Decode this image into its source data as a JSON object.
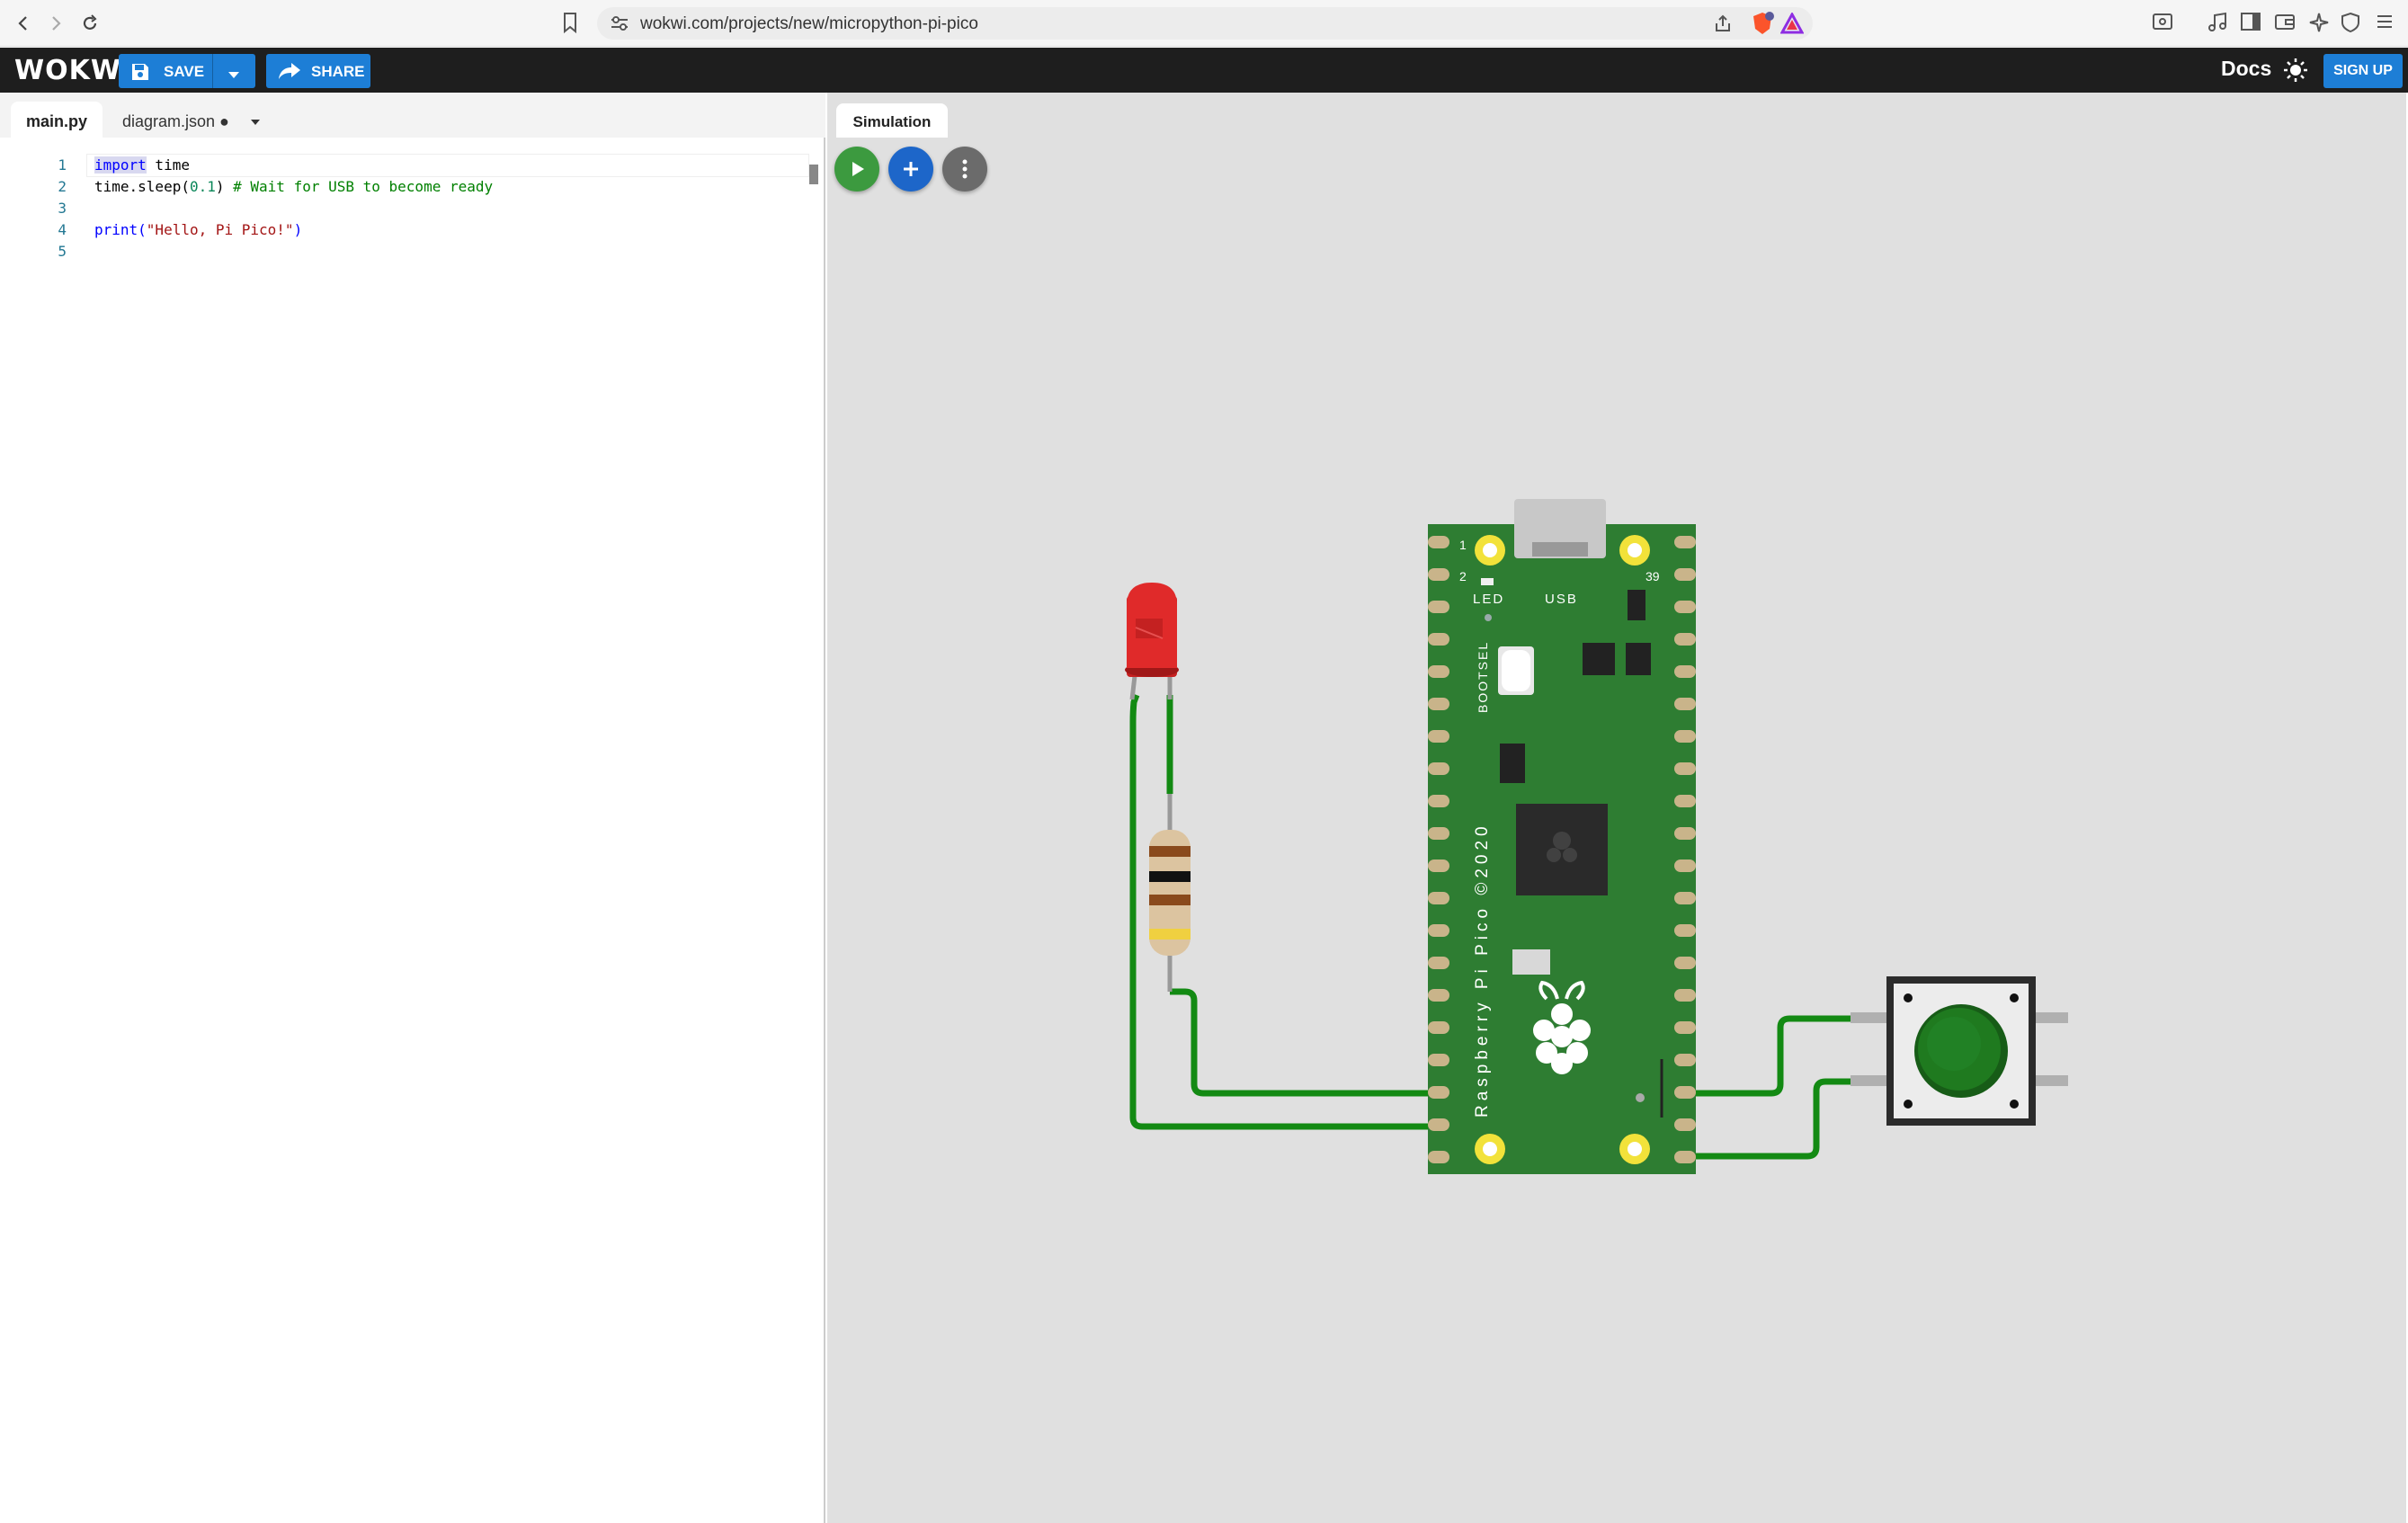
{
  "browser": {
    "url": "wokwi.com/projects/new/micropython-pi-pico"
  },
  "header": {
    "logo": "WOKWi",
    "save_label": "SAVE",
    "share_label": "SHARE",
    "docs_label": "Docs",
    "signup_label": "SIGN UP"
  },
  "editor": {
    "tabs": [
      {
        "label": "main.py"
      },
      {
        "label": "diagram.json ●"
      }
    ],
    "lines": [
      {
        "n": "1"
      },
      {
        "n": "2"
      },
      {
        "n": "3"
      },
      {
        "n": "4"
      },
      {
        "n": "5"
      }
    ],
    "code": {
      "l1_kw": "import",
      "l1_rest": " time",
      "l2_a": "time.sleep(",
      "l2_num": "0.1",
      "l2_b": ") ",
      "l2_comment": "# Wait for USB to become ready",
      "l4_fn": "print(",
      "l4_str": "\"Hello, Pi Pico!\"",
      "l4_end": ")"
    }
  },
  "simulation": {
    "tab_label": "Simulation",
    "board": {
      "led_label": "LED",
      "usb_label": "USB",
      "bootsel_label": "BOOTSEL",
      "brand_label": "Raspberry Pi Pico ©2020",
      "pin_1": "1",
      "pin_2": "2",
      "pin_39": "39"
    }
  },
  "colors": {
    "accent": "#1d7ed6",
    "play": "#3c9a3f",
    "board_green": "#2e7d32",
    "wire_green": "#138a13",
    "led_red": "#e02020",
    "button_green": "#1f7a1f"
  }
}
